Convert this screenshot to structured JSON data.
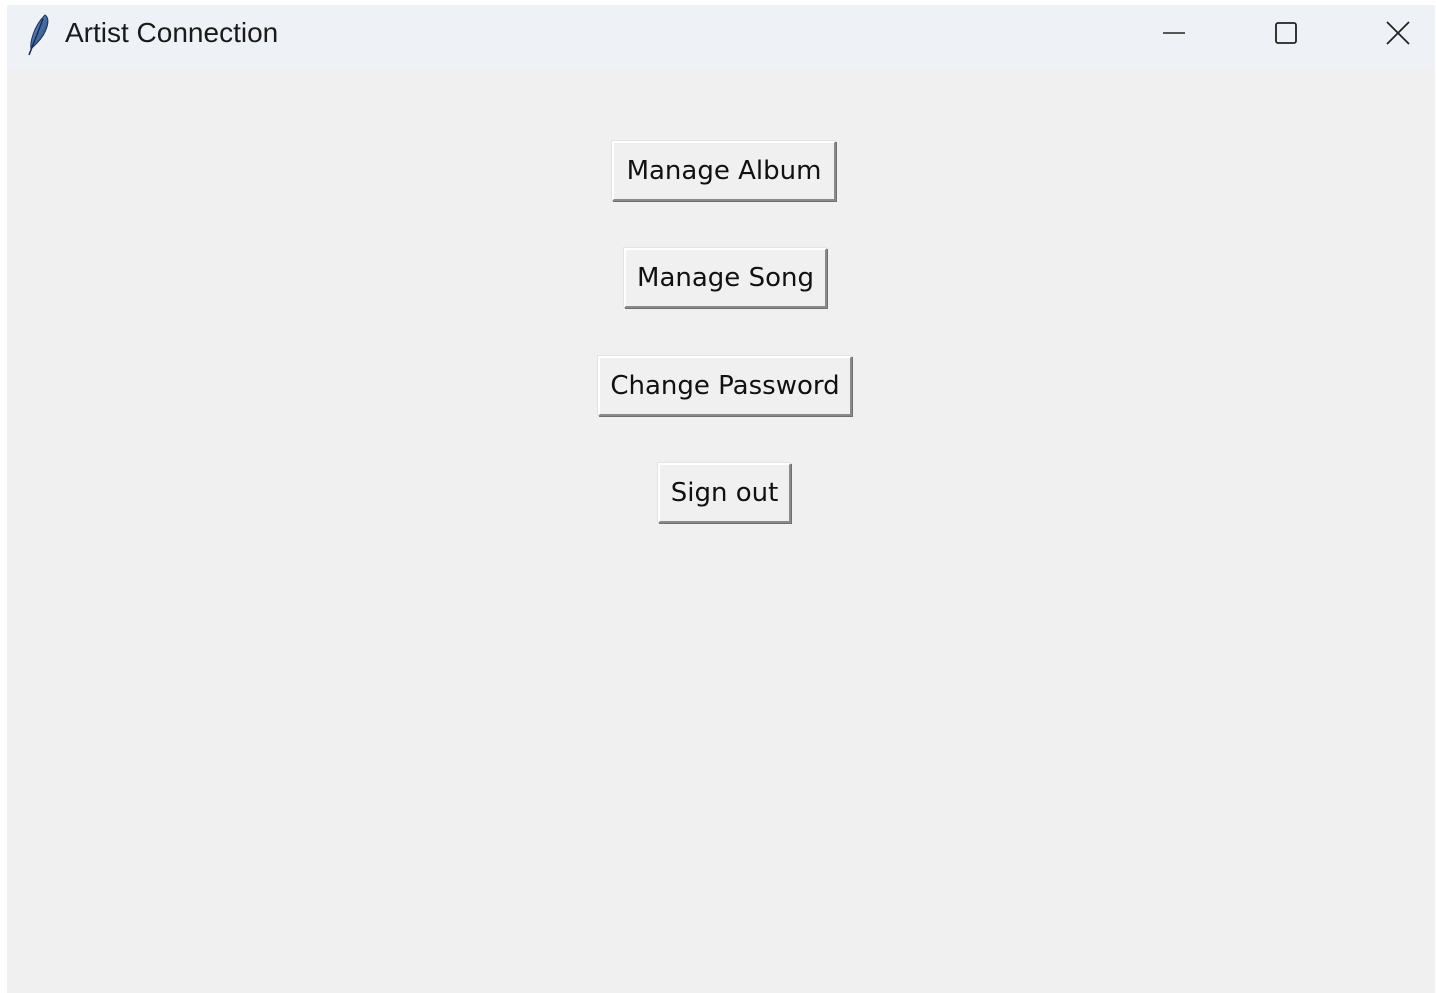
{
  "window": {
    "title": "Artist Connection",
    "icon": "feather-icon",
    "controls": {
      "minimize_icon": "minimize-icon",
      "maximize_icon": "maximize-icon",
      "close_icon": "close-icon"
    }
  },
  "menu": {
    "buttons": [
      {
        "label": "Manage Album"
      },
      {
        "label": "Manage Song"
      },
      {
        "label": "Change Password"
      },
      {
        "label": "Sign out"
      }
    ]
  },
  "colors": {
    "titlebar_bg": "#eef1f5",
    "window_bg": "#f0f0f0"
  }
}
